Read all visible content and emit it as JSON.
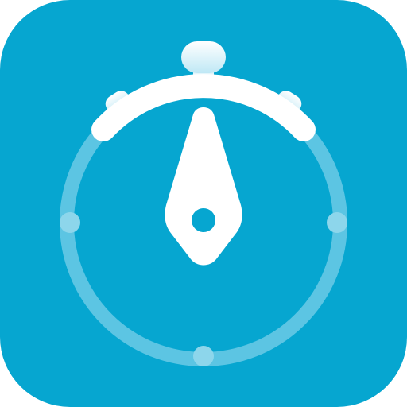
{
  "icon": {
    "name": "stopwatch-icon",
    "colors": {
      "background": "#06A6D0",
      "foreground": "#FFFFFF",
      "ring": "#5CC5E3",
      "ring_dots": "#8DD6EB",
      "button_gradient_top": "#FFFFFF",
      "button_gradient_bottom": "#BFE8F5"
    }
  }
}
